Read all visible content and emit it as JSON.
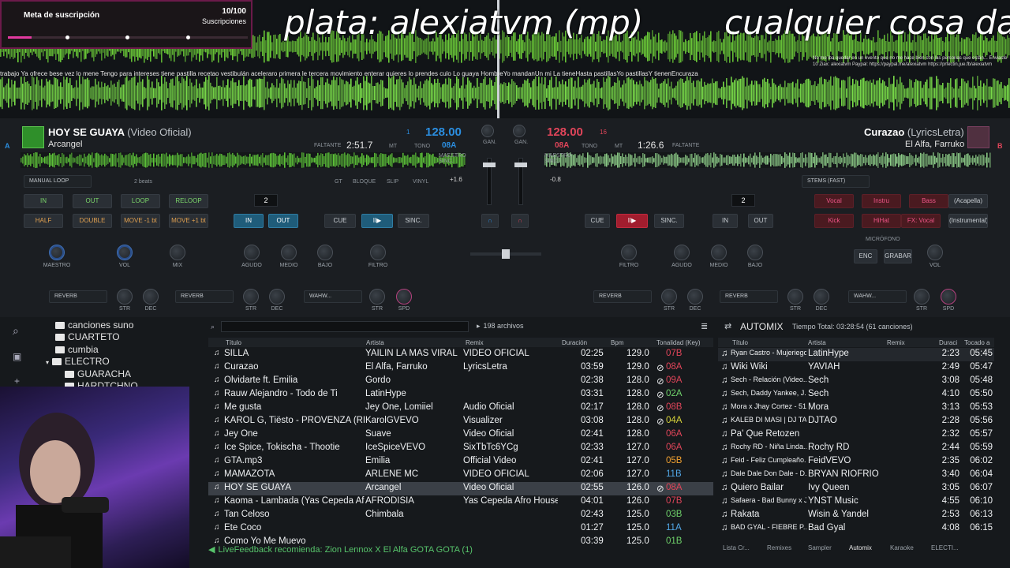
{
  "overlay": {
    "title_left": "plata: alexiatvm (mp)",
    "title_right": "cualquier cosa dar",
    "lyrics": "trabajo Ya ofrece bese vez lo mene Tengo para intereses tiene pastilla recetao vestibulán aceleraro primera le tercera movimiento enterar quieres lo prendes culo Lo guaya HombreYo mandanUn mi La tieneHasta pastillasYo pastillasY tienenEncuraza",
    "chat": "No me iba quedar en un evento que no me hace bien con las personas que están... Enviaste 10 Ziax: alexiatvm Paypal: https://paypal.me/alexiatvm https://prfectin.jue.fb/alexiatvm"
  },
  "sub_goal": {
    "label": "Meta de suscripción",
    "count": "10/100",
    "unit": "Suscripciones",
    "progress": 0.1,
    "accent": "#e23aa0"
  },
  "deck_left": {
    "letter": "A",
    "title": "HOY SE GUAYA",
    "title_sub": "(Video Oficial)",
    "artist": "Arcangel",
    "remaining_label": "FALTANTE",
    "remaining": "2:51.7",
    "bpm": "128.00",
    "key": "08A",
    "channel": "1",
    "mode_label": "MT",
    "tone_label": "TONO",
    "sync_label": "MAESTRO SINC.",
    "loop_mode": "MANUAL LOOP",
    "beats_label": "2 beats",
    "pitch": "+1.6",
    "loop_value": "2",
    "color": "#2b8ee0"
  },
  "deck_right": {
    "letter": "B",
    "title": "Curazao",
    "title_sub": "(LyricsLetra)",
    "artist": "El Alfa, Farruko",
    "remaining_label": "FALTANTE",
    "remaining": "1:26.6",
    "bpm": "128.00",
    "key": "08A",
    "channel": "16",
    "mode_label": "MT",
    "tone_label": "TONO",
    "sync_label": "MAESTRO SINC.",
    "pitch": "-0.8",
    "loop_value": "2",
    "stems_label": "STEMS (FAST)",
    "color": "#e0455a"
  },
  "pads_left": [
    "IN",
    "OUT",
    "LOOP",
    "RELOOP",
    "HALF",
    "DOUBLE",
    "MOVE -1 bt",
    "MOVE +1 bt"
  ],
  "pads_right": [
    "Vocal",
    "Instru",
    "Bass",
    "(Acapella)",
    "Kick",
    "HiHat",
    "FX: Vocal",
    "(Instrumental)"
  ],
  "transport": {
    "cue": "CUE",
    "play": "II▶",
    "sync": "SINC.",
    "in": "IN",
    "out": "OUT",
    "gt": "GT",
    "blogue": "BLOQUE",
    "slip": "SLIP",
    "vinyl": "VINYL"
  },
  "mixer": {
    "gain": "GAN.",
    "master": "MAESTRO",
    "vol": "VOL",
    "mix": "MIX",
    "treble": "AGUDO",
    "mid": "MEDIO",
    "bass": "BAJO",
    "filter": "FILTRO",
    "mic": "MICRÓFONO",
    "enc": "ENC",
    "record": "GRABAR",
    "deck": "DECK"
  },
  "fx": {
    "reverb": "REVERB",
    "wahwah": "WAHW...",
    "str": "STR",
    "dec": "DEC",
    "spd": "SPD"
  },
  "browser": {
    "file_count": "198 archivos",
    "folders": [
      "canciones suno",
      "CUARTETO",
      "cumbia",
      "ELECTRO",
      "GUARACHA",
      "HARDTCHNO"
    ],
    "headers": {
      "title": "Título",
      "artist": "Artista",
      "remix": "Remix",
      "duration": "Duración",
      "bpm": "Bpm",
      "key": "Tonalidad (Key)"
    },
    "tracks": [
      {
        "title": "SILLA",
        "artist": "YAILIN LA MAS VIRAL",
        "remix": "VIDEO OFICIAL",
        "duration": "02:25",
        "bpm": "129.0",
        "key": "07B",
        "kc": "red"
      },
      {
        "title": "Curazao",
        "artist": "El Alfa, Farruko",
        "remix": "LyricsLetra",
        "duration": "03:59",
        "bpm": "129.0",
        "key": "08A",
        "kc": "red",
        "mark": "⊘"
      },
      {
        "title": "Olvidarte ft. Emilia",
        "artist": "Gordo",
        "remix": "",
        "duration": "02:38",
        "bpm": "128.0",
        "key": "09A",
        "kc": "red",
        "mark": "⊘"
      },
      {
        "title": "Rauw Alejandro - Todo de Ti",
        "artist": "LatinHype",
        "remix": "",
        "duration": "03:31",
        "bpm": "128.0",
        "key": "02A",
        "kc": "green",
        "mark": "⊘"
      },
      {
        "title": "Me gusta",
        "artist": "Jey One, Lomiiel",
        "remix": "Audio Oficial",
        "duration": "02:17",
        "bpm": "128.0",
        "key": "08B",
        "kc": "red",
        "mark": "⊘"
      },
      {
        "title": "KAROL G, Tiësto - PROVENZA (REMIX) (Visua...",
        "artist": "KarolGVEVO",
        "remix": "Visualizer",
        "duration": "03:08",
        "bpm": "128.0",
        "key": "04A",
        "kc": "yellow",
        "mark": "⊘"
      },
      {
        "title": "Jey One",
        "artist": "Suave",
        "remix": "Video Oficial",
        "duration": "02:41",
        "bpm": "128.0",
        "key": "06A",
        "kc": "red"
      },
      {
        "title": "Ice Spice, Tokischa - Thootie",
        "artist": "IceSpiceVEVO",
        "remix": "SixTbTc6YCg",
        "duration": "02:33",
        "bpm": "127.0",
        "key": "06A",
        "kc": "red"
      },
      {
        "title": "GTA.mp3",
        "artist": "Emilia",
        "remix": "Official Video",
        "duration": "02:41",
        "bpm": "127.0",
        "key": "05B",
        "kc": "orange"
      },
      {
        "title": "MAMAZOTA",
        "artist": "ARLENE MC",
        "remix": "VIDEO OFICIAL",
        "duration": "02:06",
        "bpm": "127.0",
        "key": "11B",
        "kc": "blue"
      },
      {
        "title": "HOY SE GUAYA",
        "artist": "Arcangel",
        "remix": "Video Oficial",
        "duration": "02:55",
        "bpm": "126.0",
        "key": "08A",
        "kc": "red",
        "mark": "⊘",
        "selected": true
      },
      {
        "title": "Kaoma - Lambada (Yas Cepeda Afro House Re...",
        "artist": "AFRODISIA",
        "remix": "Yas Cepeda Afro House Remix",
        "duration": "04:01",
        "bpm": "126.0",
        "key": "07B",
        "kc": "red"
      },
      {
        "title": "Tan Celoso",
        "artist": "Chimbala",
        "remix": "",
        "duration": "02:43",
        "bpm": "125.0",
        "key": "03B",
        "kc": "green"
      },
      {
        "title": "Ete Coco",
        "artist": "",
        "remix": "",
        "duration": "01:27",
        "bpm": "125.0",
        "key": "11A",
        "kc": "blue"
      },
      {
        "title": "Como Yo Me Muevo",
        "artist": "",
        "remix": "",
        "duration": "03:39",
        "bpm": "125.0",
        "key": "01B",
        "kc": "green"
      }
    ],
    "status": "LiveFeedback recomienda: Zion  Lennox X El Alfa   GOTA GOTA (1)"
  },
  "automix": {
    "title": "AUTOMIX",
    "total": "Tiempo Total: 03:28:54 (61 canciones)",
    "headers": {
      "title": "Título",
      "artist": "Artista",
      "remix": "Remix",
      "duration": "Duraci",
      "total": "Tocado a"
    },
    "tracks": [
      {
        "title": "Ryan Castro - Mujeriego",
        "artist": "LatinHype",
        "duration": "2:23",
        "at": "05:45"
      },
      {
        "title": "Wiki Wiki",
        "artist": "YAVIAH",
        "duration": "2:49",
        "at": "05:47"
      },
      {
        "title": "Sech - Relación (Video...",
        "artist": "Sech",
        "duration": "3:08",
        "at": "05:48"
      },
      {
        "title": "Sech, Daddy Yankee, J...",
        "artist": "Sech",
        "duration": "4:10",
        "at": "05:50"
      },
      {
        "title": "Mora x Jhay Cortez - 51...",
        "artist": "Mora",
        "duration": "3:13",
        "at": "05:53"
      },
      {
        "title": "KALEB DI MASI | DJ TA...",
        "artist": "DJTAO",
        "duration": "2:28",
        "at": "05:56"
      },
      {
        "title": "Pa' Que Retozen",
        "artist": "",
        "duration": "2:32",
        "at": "05:57"
      },
      {
        "title": "Rochy RD - Niña Linda...",
        "artist": "Rochy RD",
        "duration": "2:44",
        "at": "05:59"
      },
      {
        "title": "Feid - Feliz Cumpleaño...",
        "artist": "FeidVEVO",
        "duration": "2:35",
        "at": "06:02"
      },
      {
        "title": "Dale Dale Don Dale - D...",
        "artist": "BRYAN RIOFRIO",
        "duration": "3:40",
        "at": "06:04"
      },
      {
        "title": "Quiero Bailar",
        "artist": "Ivy Queen",
        "duration": "3:05",
        "at": "06:07"
      },
      {
        "title": "Safaera - Bad Bunny x J...",
        "artist": "YNST Music",
        "duration": "4:55",
        "at": "06:10"
      },
      {
        "title": "Rakata",
        "artist": "Wisin & Yandel",
        "duration": "2:53",
        "at": "06:13"
      },
      {
        "title": "BAD GYAL - FIEBRE P...",
        "artist": "Bad Gyal",
        "duration": "4:08",
        "at": "06:15"
      }
    ],
    "tabs": [
      "Lista Cr...",
      "Remixes",
      "Sampler",
      "Automix",
      "Karaoke",
      "ELECTI..."
    ]
  }
}
